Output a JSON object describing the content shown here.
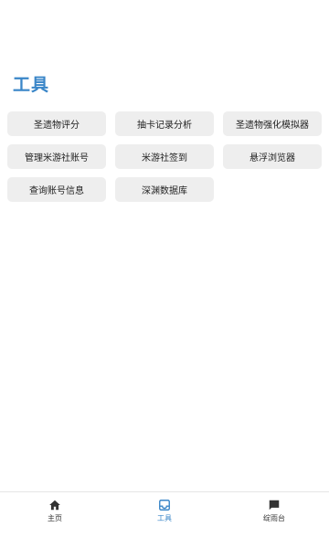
{
  "page": {
    "title": "工具"
  },
  "tools": [
    {
      "label": "圣遗物评分"
    },
    {
      "label": "抽卡记录分析"
    },
    {
      "label": "圣遗物强化模拟器"
    },
    {
      "label": "管理米游社账号"
    },
    {
      "label": "米游社签到"
    },
    {
      "label": "悬浮浏览器"
    },
    {
      "label": "查询账号信息"
    },
    {
      "label": "深渊数据库"
    }
  ],
  "nav": {
    "items": [
      {
        "label": "主页",
        "icon": "home-icon",
        "active": false
      },
      {
        "label": "工具",
        "icon": "inbox-icon",
        "active": true
      },
      {
        "label": "绽雨台",
        "icon": "chat-icon",
        "active": false
      }
    ],
    "active_color": "#3a86c8"
  }
}
